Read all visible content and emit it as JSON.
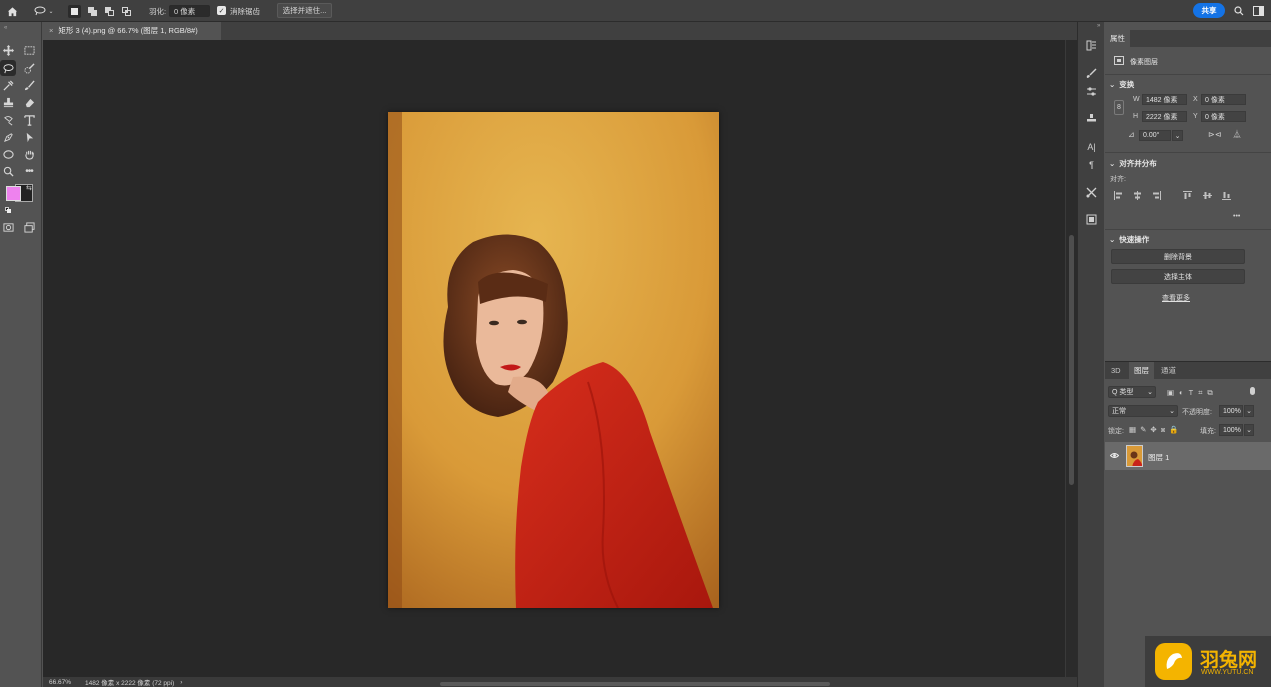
{
  "optionbar": {
    "feather_label": "羽化:",
    "feather_value": "0 像素",
    "antialias_label": "消除锯齿",
    "select_mask_label": "选择并遮住...",
    "share_label": "共享"
  },
  "document": {
    "tab_title": "矩形 3 (4).png @ 66.7% (图层 1, RGB/8#)",
    "close_glyph": "×"
  },
  "status": {
    "zoom": "66.67%",
    "doc_info": "1482 像素 x 2222 像素 (72 ppi)",
    "arrow": "›"
  },
  "properties": {
    "tab_label": "属性",
    "layer_type": "像素图层",
    "transform_title": "变换",
    "w_label": "W",
    "w_value": "1482 像素",
    "x_label": "X",
    "x_value": "0 像素",
    "h_label": "H",
    "h_value": "2222 像素",
    "y_label": "Y",
    "y_value": "0 像素",
    "angle_value": "0.00°",
    "align_title": "对齐并分布",
    "align_label": "对齐:",
    "more_glyph": "•••",
    "quick_title": "快速操作",
    "remove_bg": "删除背景",
    "select_subject": "选择主体",
    "see_more": "查看更多"
  },
  "layers_panel": {
    "tabs": [
      "3D",
      "图层",
      "通道"
    ],
    "filter_kind": "Q 类型",
    "blend_mode": "正常",
    "opacity_label": "不透明度:",
    "opacity_value": "100%",
    "lock_label": "锁定:",
    "fill_label": "填充:",
    "fill_value": "100%",
    "layer_name": "图层 1"
  },
  "colors": {
    "foreground": "#ee82ee",
    "background": "#222222",
    "accent": "#1473e6"
  },
  "watermark": {
    "name": "羽兔网",
    "url": "WWW.YUTU.CN"
  }
}
